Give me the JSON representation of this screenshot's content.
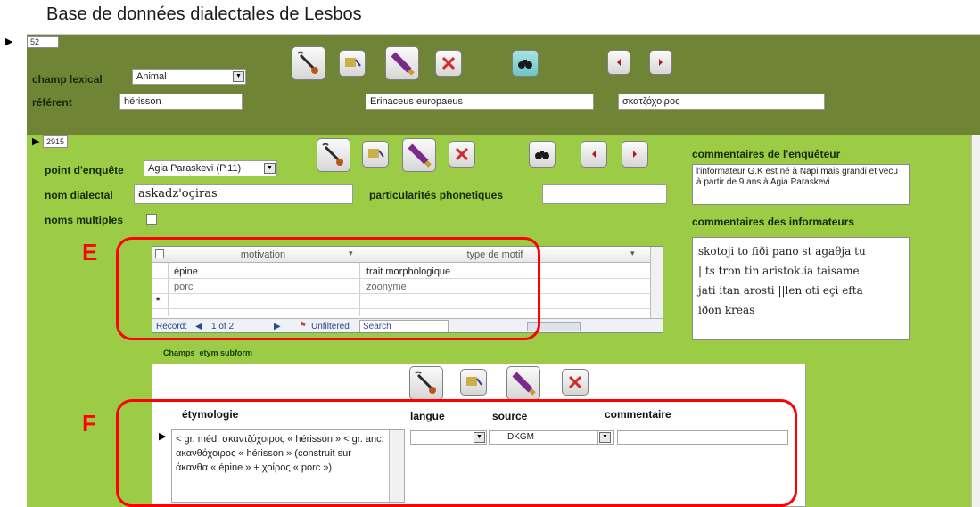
{
  "app": {
    "title": "Base de données dialectales de Lesbos"
  },
  "main_record": {
    "id": "52",
    "champ_lexical": {
      "label": "champ lexical",
      "value": "Animal"
    },
    "referent": {
      "label": "référent",
      "french": "hérisson",
      "latin": "Erinaceus europaeus",
      "greek": "σκατζόχοιρος"
    }
  },
  "sub_record": {
    "id": "2915",
    "point_enquete": {
      "label": "point d'enquête",
      "value": "Agia Paraskevi (P.11)"
    },
    "nom_dialectal": {
      "label": "nom dialectal",
      "value": "askadz'oçiras"
    },
    "particularites": {
      "label": "particularités phonetiques",
      "value": ""
    },
    "noms_multiples": {
      "label": "noms multiples"
    },
    "commentaires_enqueteur": {
      "label": "commentaires de l'enquêteur",
      "value": "l'informateur G.K est né à Napi mais grandi et vecu à partir de 9 ans à Agia Paraskevi"
    },
    "commentaires_informateurs": {
      "label": "commentaires des informateurs",
      "lines": [
        "skotoji to fiði pano st agaθja tu",
        "| ts tron tin aristok.ía taisame",
        "jati itan arosti ||len oti eçi efta",
        "iðon kreas"
      ]
    }
  },
  "motif_grid": {
    "headers": [
      "motivation",
      "type de motif"
    ],
    "rows": [
      [
        "épine",
        "trait morphologique"
      ],
      [
        "porc",
        "zoonyme"
      ]
    ],
    "new_row_marker": "*",
    "nav": {
      "record_label": "Record:",
      "position": "1 of 2",
      "filter": "Unfiltered",
      "search": "Search"
    }
  },
  "etym_subform": {
    "caption": "Champs_etym subform",
    "headers": {
      "etymologie": "étymologie",
      "langue": "langue",
      "source": "source",
      "commentaire": "commentaire"
    },
    "row": {
      "etymologie": "< gr. méd. σκαντζόχοιρος « hérisson » < gr. anc. ακανθόχοιρος « hérisson » (construit sur άκανθα « épine » + χοίρος « porc »)",
      "langue": "",
      "source": "DKGM",
      "commentaire": ""
    }
  },
  "annotations": {
    "e": "E",
    "f": "F"
  },
  "icons": {
    "edit": "pen-edit-icon",
    "tag": "tag-icon",
    "pencil": "pencil-icon",
    "delete": "delete-icon",
    "search": "binoculars-icon",
    "prev": "arrow-left-icon",
    "next": "arrow-right-icon"
  },
  "colors": {
    "top_band": "#6f8434",
    "main_band": "#9ccc45",
    "highlight": "#ff0000"
  }
}
